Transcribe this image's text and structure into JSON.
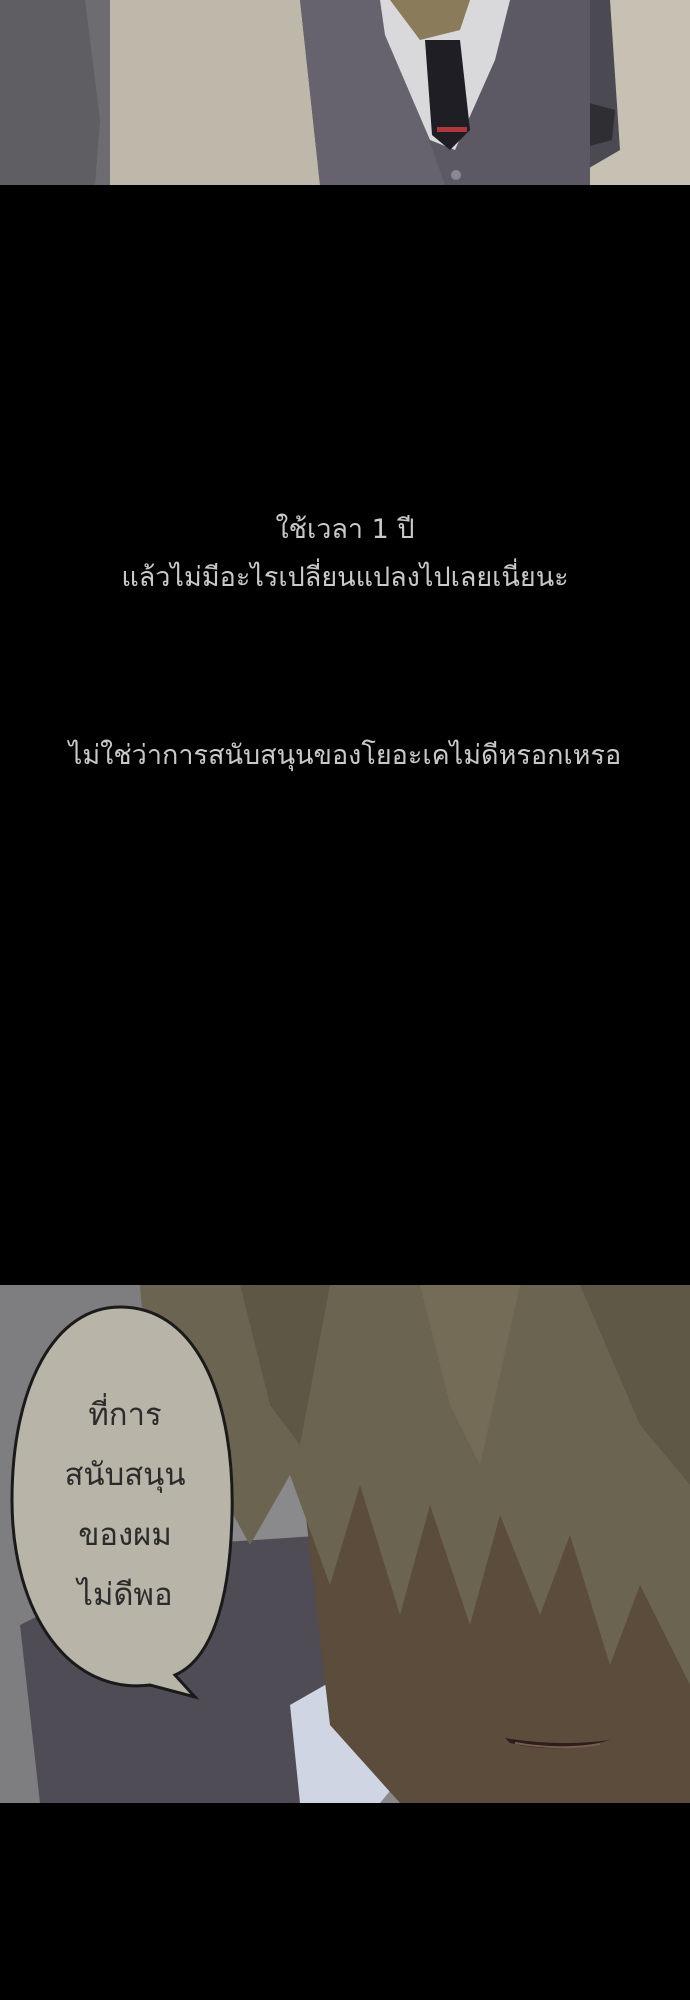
{
  "narration": {
    "line1": "ใช้เวลา 1 ปี",
    "line2": "แล้วไม่มีอะไรเปลี่ยนแปลงไปเลยเนี่ยนะ",
    "line3": "ไม่ใช่ว่าการสนับสนุนของโยอะเคไม่ดีหรอกเหรอ"
  },
  "speech_bubble": {
    "lines": [
      "ที่การ",
      "สนับสนุน",
      "ของผม",
      "ไม่ดีพอ"
    ]
  },
  "colors": {
    "background": "#000000",
    "narration_text": "#c9c9c9",
    "bubble_fill": "#b8b5a8",
    "hair": "#6b6450",
    "cardigan": "#5a5660"
  }
}
